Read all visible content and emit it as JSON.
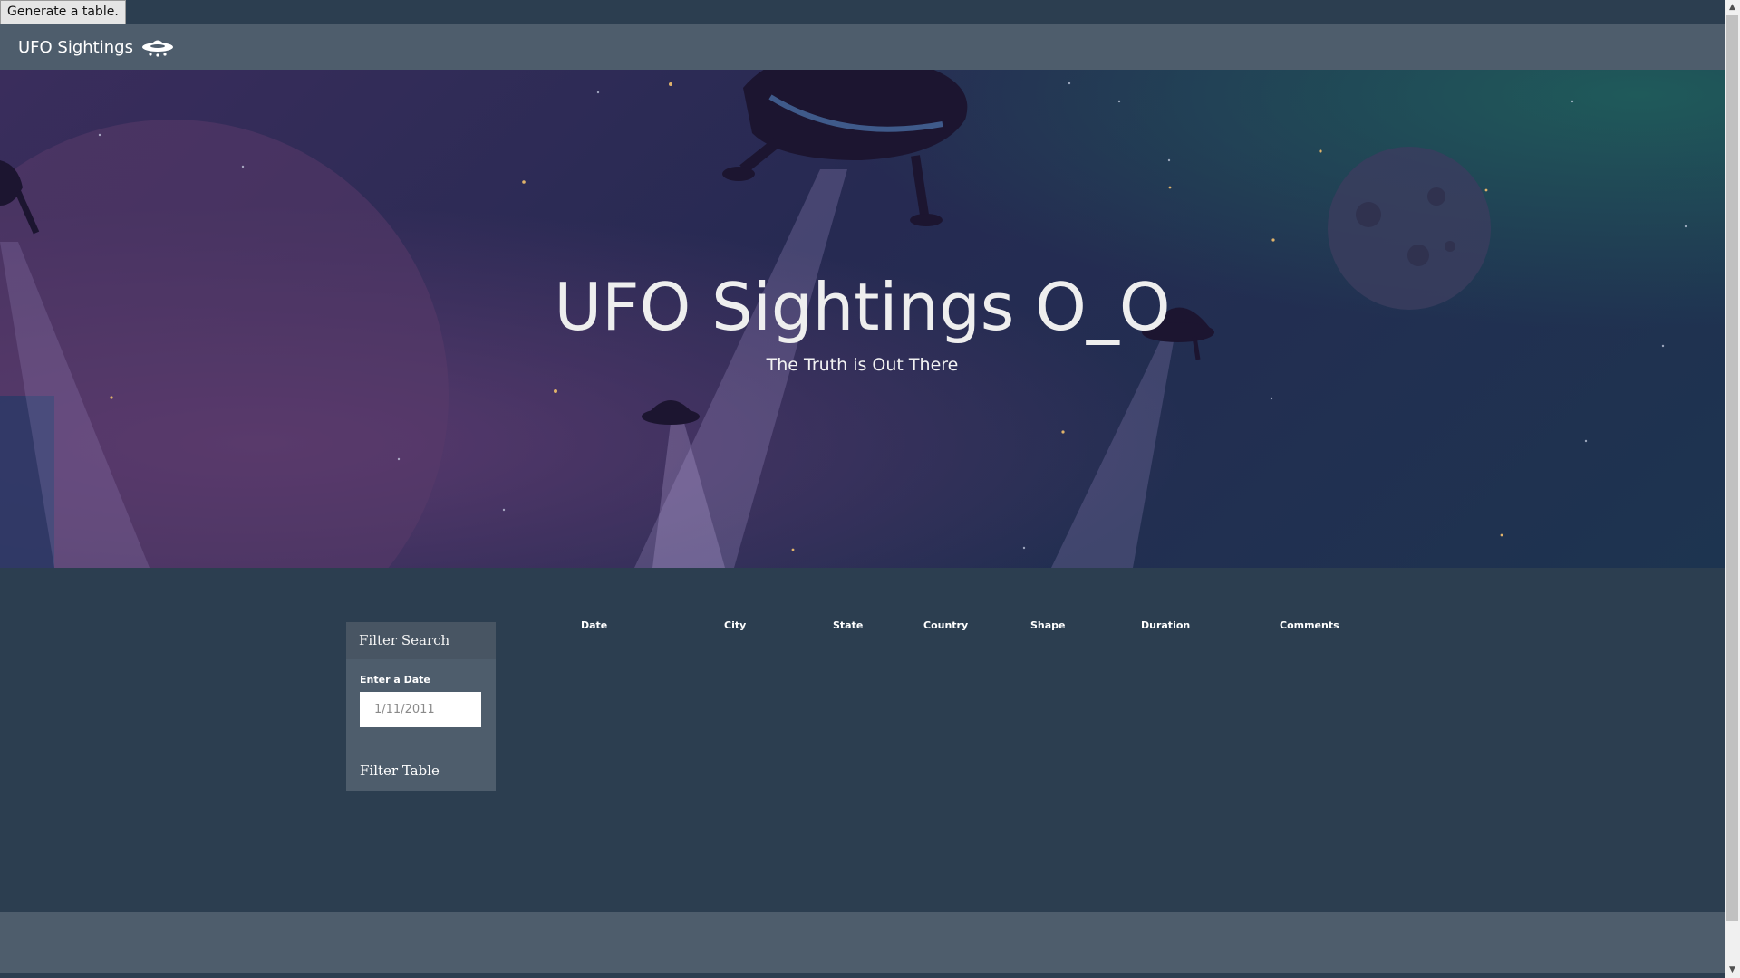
{
  "top_button": {
    "label": "Generate a table."
  },
  "navbar": {
    "brand": "UFO Sightings",
    "brand_icon": "ufo-icon"
  },
  "hero": {
    "title": "UFO Sightings O_O",
    "subtitle": "The Truth is Out There"
  },
  "filter": {
    "heading": "Filter Search",
    "date_label": "Enter a Date",
    "date_placeholder": "1/11/2011",
    "button_label": "Filter Table"
  },
  "table": {
    "columns": [
      "Date",
      "City",
      "State",
      "Country",
      "Shape",
      "Duration",
      "Comments"
    ]
  },
  "colors": {
    "page_bg": "#2c3e50",
    "navbar_bg": "#4e5d6c",
    "panel_bg": "#4e5d6c"
  }
}
